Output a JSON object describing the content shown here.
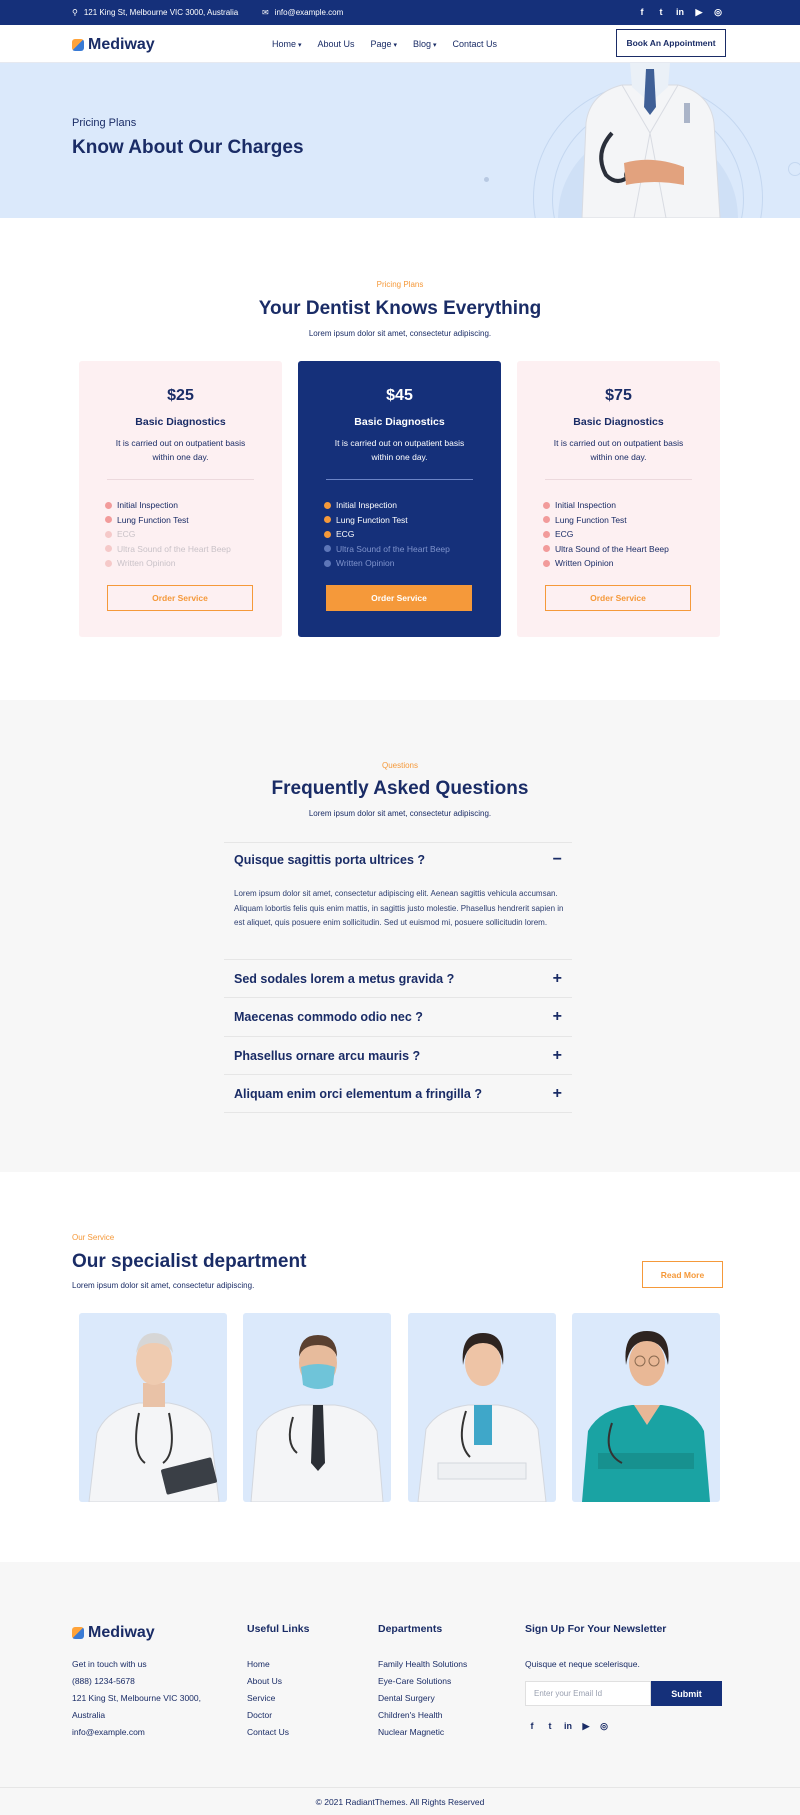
{
  "topbar": {
    "address": "121 King St, Melbourne VIC 3000, Australia",
    "email": "info@example.com",
    "social_icons": [
      "facebook-icon",
      "twitter-icon",
      "linkedin-icon",
      "youtube-icon",
      "instagram-icon"
    ]
  },
  "header": {
    "logo": "Mediway",
    "nav": [
      "Home",
      "About Us",
      "Page",
      "Blog",
      "Contact Us"
    ],
    "cta": "Book An Appointment"
  },
  "hero": {
    "eyebrow": "Pricing Plans",
    "title": "Know About Our Charges"
  },
  "pricing": {
    "eyebrow": "Pricing Plans",
    "title": "Your Dentist Knows Everything",
    "subtitle": "Lorem ipsum dolor sit amet, consectetur adipiscing.",
    "plans": [
      {
        "price": "$25",
        "title": "Basic Diagnostics",
        "desc": "It is carried out on outpatient basis within one day.",
        "features": [
          "Initial Inspection",
          "Lung Function Test",
          "ECG",
          "Ultra Sound of the Heart Beep",
          "Written Opinion"
        ],
        "included": 2,
        "button": "Order Service"
      },
      {
        "price": "$45",
        "title": "Basic Diagnostics",
        "desc": "It is carried out on outpatient basis within one day.",
        "features": [
          "Initial Inspection",
          "Lung Function Test",
          "ECG",
          "Ultra Sound of the Heart Beep",
          "Written Opinion"
        ],
        "included": 3,
        "button": "Order Service"
      },
      {
        "price": "$75",
        "title": "Basic Diagnostics",
        "desc": "It is carried out on outpatient basis within one day.",
        "features": [
          "Initial Inspection",
          "Lung Function Test",
          "ECG",
          "Ultra Sound of the Heart Beep",
          "Written Opinion"
        ],
        "included": 5,
        "button": "Order Service"
      }
    ]
  },
  "faq": {
    "eyebrow": "Questions",
    "title": "Frequently Asked Questions",
    "subtitle": "Lorem ipsum dolor sit amet, consectetur adipiscing.",
    "items": [
      {
        "q": "Quisque sagittis porta ultrices ?",
        "icon": "−",
        "open": true,
        "a": "Lorem ipsum dolor sit amet, consectetur adipiscing elit. Aenean sagittis vehicula accumsan. Aliquam lobortis felis quis enim mattis, in sagittis justo molestie. Phasellus hendrerit sapien in est aliquet, quis posuere enim sollicitudin. Sed ut euismod mi, posuere sollicitudin lorem."
      },
      {
        "q": "Sed sodales lorem a metus gravida ?",
        "icon": "+"
      },
      {
        "q": "Maecenas commodo odio nec ?",
        "icon": "+"
      },
      {
        "q": "Phasellus ornare arcu mauris ?",
        "icon": "+"
      },
      {
        "q": "Aliquam enim orci elementum a fringilla ?",
        "icon": "+"
      }
    ]
  },
  "specialist": {
    "eyebrow": "Our Service",
    "title": "Our specialist department",
    "subtitle": "Lorem ipsum dolor sit amet, consectetur adipiscing.",
    "button": "Read More"
  },
  "footer": {
    "logo": "Mediway",
    "contact": [
      "Get in touch with us",
      "(888) 1234-5678",
      "121 King St, Melbourne VIC 3000,",
      "Australia",
      "info@example.com"
    ],
    "useful_title": "Useful Links",
    "useful": [
      "Home",
      "About Us",
      "Service",
      "Doctor",
      "Contact Us"
    ],
    "dept_title": "Departments",
    "depts": [
      "Family Health Solutions",
      "Eye-Care Solutions",
      "Dental Surgery",
      "Children's Health",
      "Nuclear Magnetic"
    ],
    "news_title": "Sign Up For Your Newsletter",
    "news_text": "Quisque et neque scelerisque.",
    "news_placeholder": "Enter your Email Id",
    "news_button": "Submit",
    "copyright": "© 2021 RadiantThemes. All Rights Reserved"
  },
  "colors": {
    "navy": "#15307a",
    "orange": "#f5993a",
    "light_blue": "#dbe9fb",
    "pink": "#fdf0f2"
  }
}
